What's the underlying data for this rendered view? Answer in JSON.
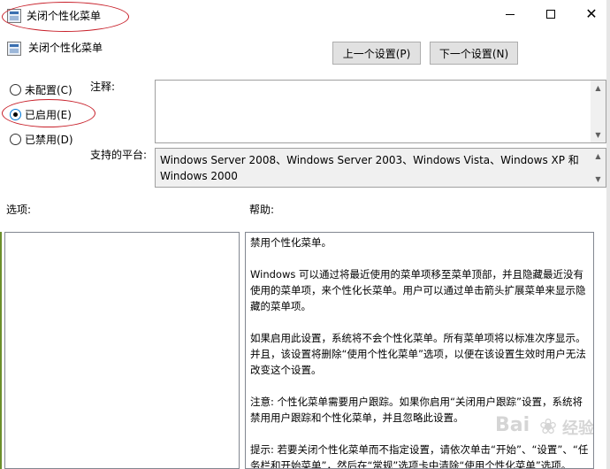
{
  "window": {
    "title": "关闭个性化菜单",
    "minimize_icon": "minimize-icon",
    "maximize_icon": "maximize-icon",
    "close_glyph": "✕"
  },
  "header": {
    "title": "关闭个性化菜单",
    "icon": "policy-icon"
  },
  "navigation": {
    "prev_label": "上一个设置(P)",
    "next_label": "下一个设置(N)"
  },
  "state_options": [
    {
      "label": "未配置(C)",
      "checked": false
    },
    {
      "label": "已启用(E)",
      "checked": true
    },
    {
      "label": "已禁用(D)",
      "checked": false
    }
  ],
  "fields": {
    "comment_label": "注释:",
    "comment_value": "",
    "platform_label": "支持的平台:",
    "platform_value": "Windows Server 2008、Windows Server 2003、Windows Vista、Windows XP 和 Windows 2000"
  },
  "sections": {
    "options_label": "选项:",
    "help_label": "帮助:"
  },
  "help": {
    "paragraphs": [
      "禁用个性化菜单。",
      "Windows 可以通过将最近使用的菜单项移至菜单顶部，并且隐藏最近没有使用的菜单项，来个性化长菜单。用户可以通过单击箭头扩展菜单来显示隐藏的菜单项。",
      "如果启用此设置，系统将不会个性化菜单。所有菜单项将以标准次序显示。并且，该设置将删除“使用个性化菜单”选项，以便在该设置生效时用户无法改变这个设置。",
      "注意: 个性化菜单需要用户跟踪。如果你启用“关闭用户跟踪”设置，系统将禁用用户跟踪和个性化菜单，并且忽略此设置。",
      "提示: 若要关闭个性化菜单而不指定设置，请依次单击“开始”、“设置”、“任务栏和开始菜单”，然后在“常规”选项卡中清除“使用个性化菜单”选项。"
    ]
  },
  "watermark": {
    "text": "Bai",
    "text2": "经验"
  },
  "colors": {
    "annotation": "#c8202a",
    "radio_selected": "#0078d7"
  }
}
